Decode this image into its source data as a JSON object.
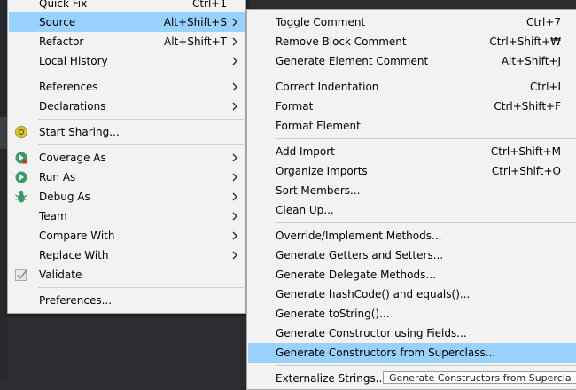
{
  "menu1": {
    "items": [
      {
        "label": "Quick Fix",
        "accel": "Ctrl+1"
      },
      {
        "label": "Source",
        "accel": "Alt+Shift+S"
      },
      {
        "label": "Refactor",
        "accel": "Alt+Shift+T"
      },
      {
        "label": "Local History"
      },
      {
        "label": "References"
      },
      {
        "label": "Declarations"
      },
      {
        "label": "Start Sharing..."
      },
      {
        "label": "Coverage As"
      },
      {
        "label": "Run As"
      },
      {
        "label": "Debug As"
      },
      {
        "label": "Team"
      },
      {
        "label": "Compare With"
      },
      {
        "label": "Replace With"
      },
      {
        "label": "Validate"
      },
      {
        "label": "Preferences..."
      }
    ]
  },
  "menu2": {
    "items": [
      {
        "label": "Toggle Comment",
        "accel": "Ctrl+7"
      },
      {
        "label": "Remove Block Comment",
        "accel": "Ctrl+Shift+₩"
      },
      {
        "label": "Generate Element Comment",
        "accel": "Alt+Shift+J"
      },
      {
        "label": "Correct Indentation",
        "accel": "Ctrl+I"
      },
      {
        "label": "Format",
        "accel": "Ctrl+Shift+F"
      },
      {
        "label": "Format Element"
      },
      {
        "label": "Add Import",
        "accel": "Ctrl+Shift+M"
      },
      {
        "label": "Organize Imports",
        "accel": "Ctrl+Shift+O"
      },
      {
        "label": "Sort Members..."
      },
      {
        "label": "Clean Up..."
      },
      {
        "label": "Override/Implement Methods..."
      },
      {
        "label": "Generate Getters and Setters..."
      },
      {
        "label": "Generate Delegate Methods..."
      },
      {
        "label": "Generate hashCode() and equals()..."
      },
      {
        "label": "Generate toString()..."
      },
      {
        "label": "Generate Constructor using Fields..."
      },
      {
        "label": "Generate Constructors from Superclass..."
      },
      {
        "label": "Externalize Strings..."
      }
    ]
  },
  "combo_text": "Generate Constructors from Supercla",
  "colors": {
    "menu_bg": "#f2f2f2",
    "selection": "#99d1ff",
    "editor_bg": "#2b2d30",
    "separator": "#cfcfcf"
  }
}
